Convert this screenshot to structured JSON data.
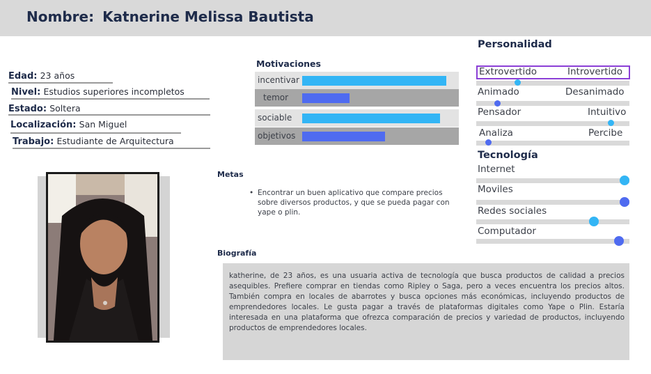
{
  "header": {
    "label": "Nombre:",
    "name": "Katnerine Melissa Bautista"
  },
  "info": {
    "edad": {
      "label": "Edad:",
      "value": "23 años"
    },
    "nivel": {
      "label": "Nivel:",
      "value": "Estudios superiores incompletos"
    },
    "estado": {
      "label": "Estado:",
      "value": "Soltera"
    },
    "localizacion": {
      "label": "Localización:",
      "value": "San Miguel"
    },
    "trabajo": {
      "label": "Trabajo:",
      "value": "Estudiante de Arquitectura"
    }
  },
  "motivaciones": {
    "title": "Motivaciones",
    "items": [
      {
        "label": "incentivar",
        "level": 0.92,
        "color": "#33b5f5"
      },
      {
        "label": "temor",
        "level": 0.3,
        "color": "#4f6bf0"
      },
      {
        "label": "sociable",
        "level": 0.88,
        "color": "#33b5f5"
      },
      {
        "label": "objetivos",
        "level": 0.53,
        "color": "#4f6bf0"
      }
    ]
  },
  "metas": {
    "title": "Metas",
    "bullet": "•",
    "text": "Encontrar un buen aplicativo que compare precios sobre diversos productos, y que se pueda pagar con yape o plin."
  },
  "biografia": {
    "title": "Biografía",
    "text": "katherine, de 23 años, es una usuaria activa de tecnología que busca productos de calidad a precios asequibles. Prefiere comprar en tiendas como Ripley o Saga, pero a veces encuentra los precios altos. También compra en locales de abarrotes y busca opciones más económicas, incluyendo productos de emprendedores locales. Le gusta pagar a través de plataformas digitales como Yape o Plin. Estaría interesada en una plataforma que ofrezca comparación de precios y variedad de productos, incluyendo productos de emprendedores locales."
  },
  "personalidad": {
    "title": "Personalidad",
    "items": [
      {
        "left": "Extrovertido",
        "right": "Introvertido",
        "level": 0.27,
        "color": "#33b5f5"
      },
      {
        "left": "Animado",
        "right": "Desanimado",
        "level": 0.14,
        "color": "#4f6bf0"
      },
      {
        "left": "Pensador",
        "right": "Intuitivo",
        "level": 0.88,
        "color": "#33b5f5"
      },
      {
        "left": "Analiza",
        "right": "Percibe",
        "level": 0.08,
        "color": "#4f6bf0"
      }
    ]
  },
  "tecnologia": {
    "title": "Tecnología",
    "items": [
      {
        "label": "Internet",
        "level": 0.97,
        "color": "#33b5f5"
      },
      {
        "label": "Moviles",
        "level": 0.97,
        "color": "#4f6bf0"
      },
      {
        "label": "Redes sociales",
        "level": 0.77,
        "color": "#33b5f5"
      },
      {
        "label": "Computador",
        "level": 0.93,
        "color": "#4f6bf0"
      }
    ]
  }
}
